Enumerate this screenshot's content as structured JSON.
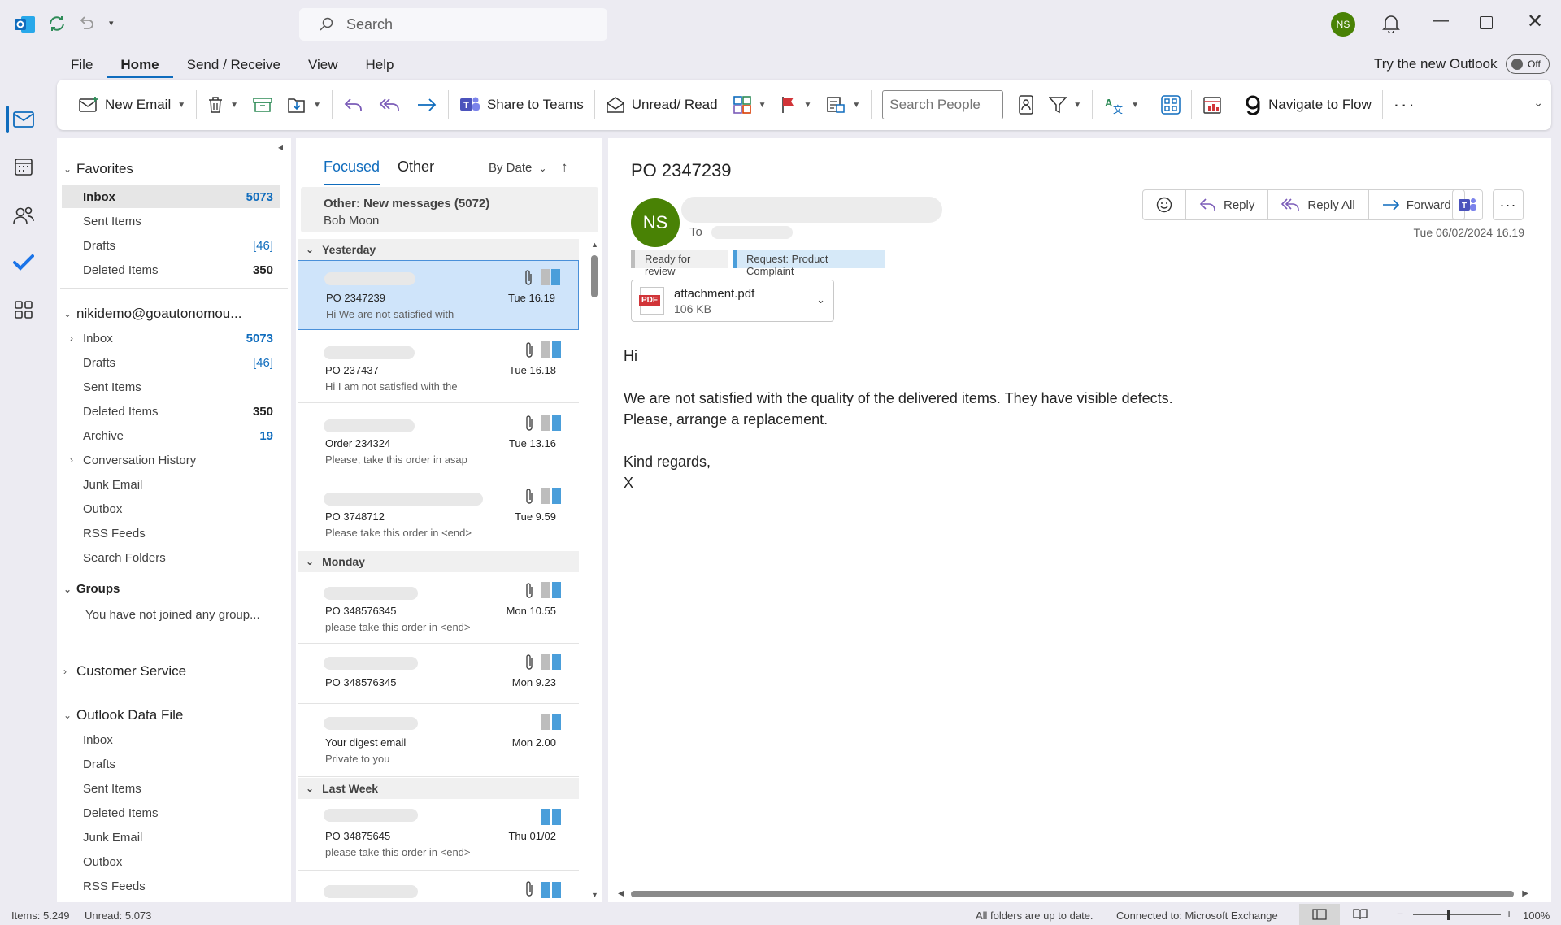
{
  "app": {
    "logo_icon": "outlook-logo-icon",
    "user_initials": "NS",
    "avatar_color": "#498205",
    "accent": "#0f6cbd"
  },
  "search": {
    "placeholder": "Search"
  },
  "menu": {
    "items": [
      "File",
      "Home",
      "Send / Receive",
      "View",
      "Help"
    ],
    "active": "Home"
  },
  "try_new": {
    "label": "Try the new Outlook",
    "toggle": "Off"
  },
  "ribbon": {
    "new_email": "New Email",
    "share_teams": "Share to Teams",
    "unread_read": "Unread/ Read",
    "search_people_placeholder": "Search People",
    "navigate_flow": "Navigate to Flow"
  },
  "nav": {
    "favorites": {
      "header": "Favorites",
      "items": [
        {
          "label": "Inbox",
          "count": "5073"
        },
        {
          "label": "Sent Items",
          "count": ""
        },
        {
          "label": "Drafts",
          "count": "[46]"
        },
        {
          "label": "Deleted Items",
          "count": "350"
        }
      ]
    },
    "account": {
      "header": "nikidemo@goautonomou...",
      "items": [
        {
          "label": "Inbox",
          "count": "5073"
        },
        {
          "label": "Drafts",
          "count": "[46]"
        },
        {
          "label": "Sent Items",
          "count": ""
        },
        {
          "label": "Deleted Items",
          "count": "350"
        },
        {
          "label": "Archive",
          "count": "19"
        },
        {
          "label": "Conversation History",
          "count": ""
        },
        {
          "label": "Junk Email",
          "count": ""
        },
        {
          "label": "Outbox",
          "count": ""
        },
        {
          "label": "RSS Feeds",
          "count": ""
        },
        {
          "label": "Search Folders",
          "count": ""
        }
      ]
    },
    "groups": {
      "header": "Groups",
      "note": "You have not joined any group..."
    },
    "customer_service": "Customer Service",
    "data_file": {
      "header": "Outlook Data File",
      "items": [
        "Inbox",
        "Drafts",
        "Sent Items",
        "Deleted Items",
        "Junk Email",
        "Outbox",
        "RSS Feeds"
      ]
    }
  },
  "list": {
    "tabs": [
      "Focused",
      "Other"
    ],
    "sort": "By Date",
    "other_banner": {
      "title": "Other: New messages (5072)",
      "sender": "Bob Moon"
    },
    "groups": [
      "Yesterday",
      "Monday",
      "Last Week"
    ],
    "messages": [
      {
        "subject": "PO 2347239",
        "preview": "Hi   We are not satisfied with",
        "time": "Tue 16.19"
      },
      {
        "subject": "PO 237437",
        "preview": "Hi  I am not satisfied with the",
        "time": "Tue 16.18"
      },
      {
        "subject": "Order 234324",
        "preview": "Please, take this order in asap",
        "time": "Tue 13.16"
      },
      {
        "subject": "PO 3748712",
        "preview": "Please take this order in <end>",
        "time": "Tue 9.59"
      },
      {
        "subject": "PO 348576345",
        "preview": "please take this order in <end>",
        "time": "Mon 10.55"
      },
      {
        "subject": "PO 348576345",
        "preview": "",
        "time": "Mon 9.23"
      },
      {
        "subject": "Your digest email",
        "preview": "Private to you",
        "time": "Mon 2.00"
      },
      {
        "subject": "PO 34875645",
        "preview": "please take this order in <end>",
        "time": "Thu 01/02"
      }
    ]
  },
  "reading": {
    "subject": "PO 2347239",
    "to_label": "To",
    "actions": {
      "reply": "Reply",
      "reply_all": "Reply All",
      "forward": "Forward"
    },
    "date": "Tue 06/02/2024 16.19",
    "tags": [
      "Ready for review",
      "Request: Product Complaint"
    ],
    "attachment": {
      "name": "attachment.pdf",
      "size": "106 KB",
      "type_label": "PDF"
    },
    "body": "Hi\n\nWe are not satisfied with the quality of the delivered items. They have visible defects.\nPlease, arrange a replacement.\n\nKind regards,\nX"
  },
  "status": {
    "items": "Items: 5.249",
    "unread": "Unread: 5.073",
    "sync": "All folders are up to date.",
    "connection": "Connected to: Microsoft Exchange",
    "zoom": "100%"
  }
}
